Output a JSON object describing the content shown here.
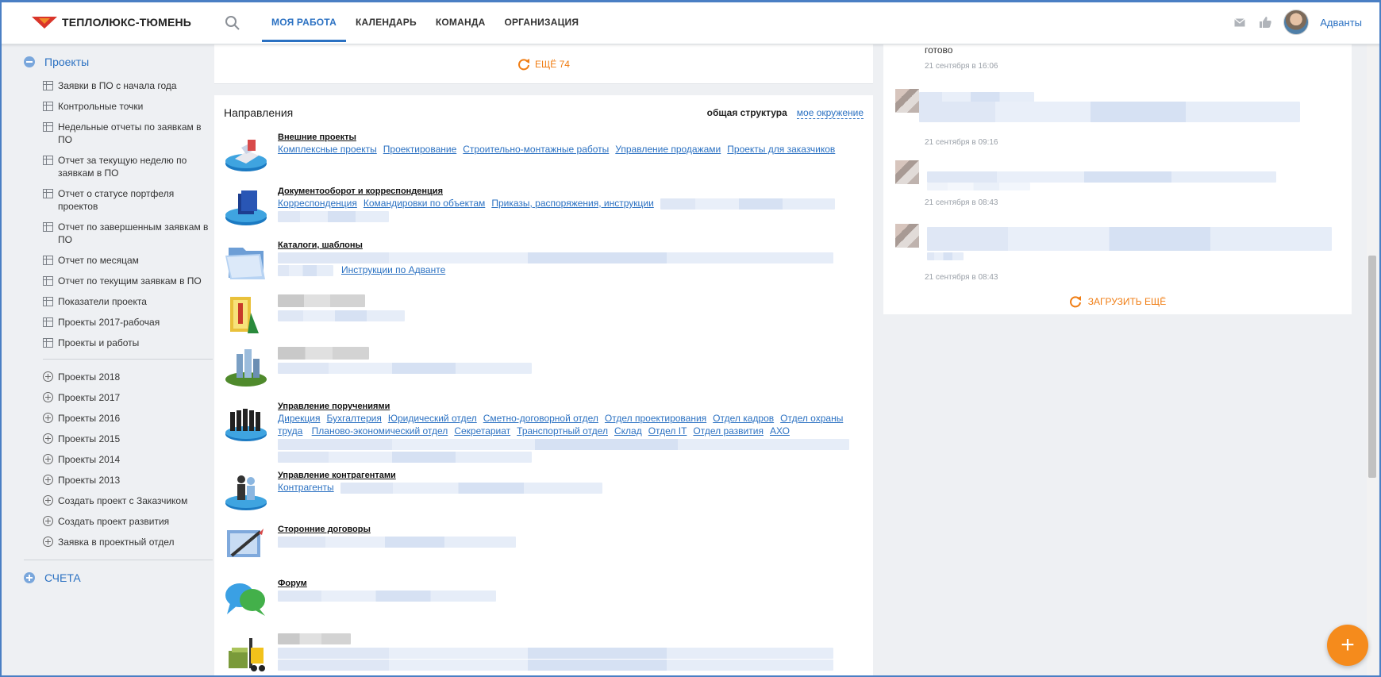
{
  "header": {
    "logo_text": "ТЕПЛОЛЮКС-ТЮМЕНЬ",
    "nav": [
      {
        "label": "МОЯ РАБОТА",
        "active": true
      },
      {
        "label": "КАЛЕНДАРЬ",
        "active": false
      },
      {
        "label": "КОМАНДА",
        "active": false
      },
      {
        "label": "ОРГАНИЗАЦИЯ",
        "active": false
      }
    ],
    "user_name": "Адванты",
    "icons": [
      "search-icon",
      "mail-icon",
      "like-icon"
    ]
  },
  "sidebar": {
    "projects_label": "Проекты",
    "reports": [
      "Заявки в ПО с начала года",
      "Контрольные точки",
      "Недельные отчеты по заявкам в ПО",
      "Отчет за текущую неделю по заявкам в ПО",
      "Отчет о статусе портфеля проектов",
      "Отчет по завершенным заявкам в ПО",
      "Отчет по месяцам",
      "Отчет по текущим заявкам в ПО",
      "Показатели проекта",
      "Проекты 2017-рабочая",
      "Проекты и работы"
    ],
    "years": [
      "Проекты 2018",
      "Проекты 2017",
      "Проекты 2016",
      "Проекты 2015",
      "Проекты 2014",
      "Проекты 2013",
      "Создать проект с Заказчиком",
      "Создать проект развития",
      "Заявка в проектный отдел"
    ],
    "accounts_label": "СЧЕТА"
  },
  "main": {
    "more_label": "ЕЩЁ 74",
    "directions_title": "Направления",
    "tab_structure": "общая структура",
    "tab_environment": "мое окружение",
    "directions": [
      {
        "name": "Внешние проекты",
        "links": [
          "Комплексные проекты",
          "Проектирование",
          "Строительно-монтажные работы",
          "Управление продажами",
          "Проекты для заказчиков"
        ]
      },
      {
        "name": "Документооборот и корреспонденция",
        "links": [
          "Корреспонденция",
          "Командировки по объектам",
          "Приказы, распоряжения, инструкции"
        ]
      },
      {
        "name": "Каталоги, шаблоны",
        "links": [
          "Инструкции по Адванте"
        ]
      },
      {
        "name": "",
        "links": []
      },
      {
        "name": "",
        "links": []
      },
      {
        "name": "Управление поручениями",
        "links": [
          "Дирекция",
          "Бухгалтерия",
          "Юридический отдел",
          "Сметно-договорной отдел",
          "Отдел проектирования",
          "Отдел кадров",
          "Отдел охраны труда",
          "Планово-экономический отдел",
          "Секретариат",
          "Транспортный отдел",
          "Склад",
          "Отдел IT",
          "Отдел развития",
          "АХО"
        ]
      },
      {
        "name": "Управление контрагентами",
        "links": [
          "Контрагенты"
        ]
      },
      {
        "name": "Сторонние договоры",
        "links": []
      },
      {
        "name": "Форум",
        "links": []
      },
      {
        "name": "",
        "links": []
      }
    ]
  },
  "feed": {
    "items": [
      {
        "text": "готово",
        "time": "21 сентября в 16:06"
      },
      {
        "text": "",
        "time": "21 сентября в 09:16"
      },
      {
        "text": "",
        "time": "21 сентября в 08:43"
      },
      {
        "text": "",
        "time": "21 сентября в 08:43"
      }
    ],
    "load_more": "ЗАГРУЗИТЬ ЕЩЁ"
  },
  "fab_label": "+",
  "colors": {
    "accent": "#2b71c2",
    "orange": "#f07d13",
    "fab": "#f58b1c"
  }
}
